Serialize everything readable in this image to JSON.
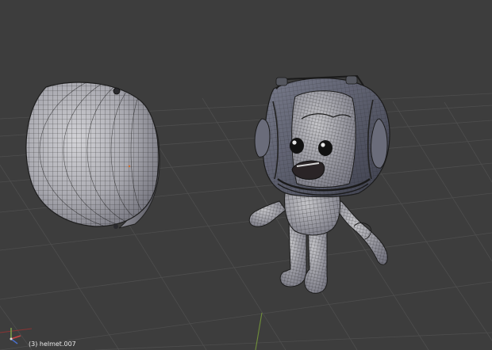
{
  "viewport": {
    "object_label": "(3) helmet.007",
    "background_color": "#3d3d3d",
    "grid_color": "#4e4e4e",
    "wire_color": "#1c1c1c",
    "axis_y_color": "#6f8f3a",
    "axis_x_color": "#8a3434"
  },
  "objects": [
    {
      "name": "helmet-dome",
      "type": "mesh"
    },
    {
      "name": "astronaut-character",
      "type": "mesh"
    }
  ],
  "gizmo": {
    "icon": "axes-orientation-icon"
  }
}
